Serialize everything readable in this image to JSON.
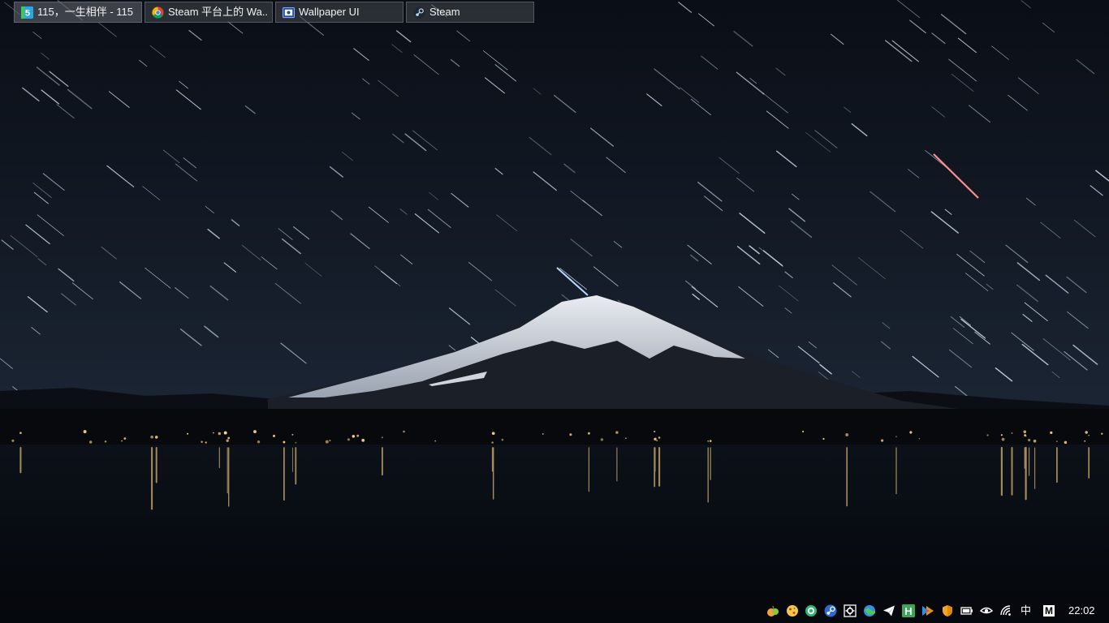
{
  "wallpaper": {
    "scene": "mountain-lake-star-trails-night",
    "colors": {
      "sky_top": "#0c1018",
      "sky_low": "#1b2533",
      "snow": "#dfe3ea",
      "water": "#060a10",
      "lights": "#ffd58a"
    }
  },
  "taskbar": {
    "buttons": [
      {
        "label": "115，一生相伴 - 115",
        "icon": "115-app-icon",
        "active": true
      },
      {
        "label": "Steam 平台上的 Wa...",
        "icon": "chrome-icon",
        "active": false
      },
      {
        "label": "Wallpaper UI",
        "icon": "wallpaper-engine-icon",
        "active": false
      },
      {
        "label": "Steam",
        "icon": "steam-icon",
        "active": false
      }
    ]
  },
  "tray": {
    "icons": [
      "fruit-app-icon",
      "cookie-app-icon",
      "ring-app-icon",
      "steam-icon",
      "gear-box-icon",
      "globe-app-icon",
      "paper-plane-icon",
      "h-app-icon",
      "multicolor-app-icon",
      "shield-icon",
      "battery-icon",
      "eye-app-icon",
      "wifi-icon"
    ],
    "ime_label": "中",
    "m_label": "M"
  },
  "clock": {
    "time": "22:02"
  }
}
